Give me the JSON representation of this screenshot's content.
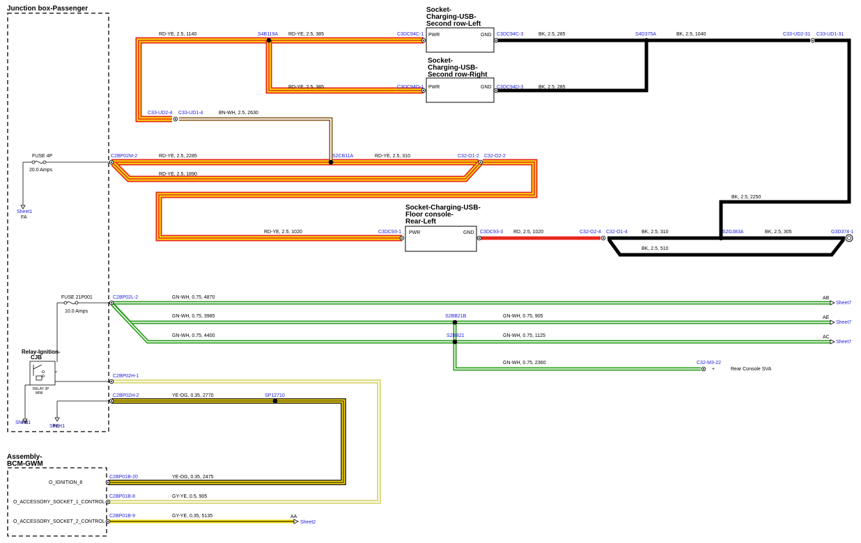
{
  "blocks": {
    "junction_box": "Junction box-Passenger",
    "bcm": [
      "Assembly-",
      "BCM-GWM"
    ],
    "usb_left": [
      "Socket-",
      "Charging-USB-",
      "Second row-Left"
    ],
    "usb_right": [
      "Socket-",
      "Charging-USB-",
      "Second row-Right"
    ],
    "usb_floor": [
      "Socket-Charging-USB-",
      "Floor console-",
      "Rear-Left"
    ],
    "relay": [
      "Relay-Ignition-",
      "CJB"
    ]
  },
  "pins": {
    "pwr": "PWR",
    "gnd": "GND"
  },
  "fuses": {
    "f4p": {
      "name": "FUSE 4P",
      "rating": "20.0 Amps"
    },
    "f21": {
      "name": "FUSE 21P001",
      "rating": "10.0 Amps"
    },
    "relay_type": [
      "RELAY 2P",
      "MINI"
    ]
  },
  "connectors": {
    "c2bp02m2": "C2BP02M-2",
    "s4b119a": "S4B119A",
    "c3dc94c1": "C3DC94C-1",
    "c3dc94c3": "C3DC94C-3",
    "s4d375a": "S4D375A",
    "c33ud231": "C33-UD2-31",
    "c33ud131": "C33-UD1-31",
    "c3dc94d1": "C3DC94D-1",
    "c3dc94d3": "C3DC94D-3",
    "c33ud24": "C33-UD2-4",
    "c33ud14": "C33-UD1-4",
    "s2cb11a": "S2CB11A",
    "c32o12": "C32-O1-2",
    "c32o22": "C32-O2-2",
    "c3dc931": "C3DC93-1",
    "c3dc933": "C3DC93-3",
    "c32o24": "C32-O2-4",
    "c32o14": "C32-O1-4",
    "s2g383a": "S2G383A",
    "g3d374": "G3D374-1",
    "c2bp02l2": "C2BP02L-2",
    "s2bb21b": "S2BB21B",
    "s2bb21": "S2BB21",
    "c32m322": "C32-M3-22",
    "c2bp02h1": "C2BP02H-1",
    "c2bp02h2": "C2BP02H-2",
    "sp12710": "SP12710",
    "c2bp01b20": "C2BP01B-20",
    "c2bp01b8": "C2BP01B-8",
    "c2bp01b9": "C2BP01B-9"
  },
  "wires": {
    "w1140": "RD-YE,  2.5,  1140",
    "w385a": "RD-YE,  2.5,  385",
    "w385b": "RD-YE,  2.5,  385",
    "bk285a": "BK,  2.5,  285",
    "bk285b": "BK,  2.5,  285",
    "bk1040": "BK,  2.5,  1040",
    "bn2630": "BN-WH,  2.5,  2630",
    "w2285": "RD-YE,  2.5,  2285",
    "w310": "RD-YE,  2.5,  310",
    "w1890": "RD-YE,  2.5,  1890",
    "bk2250": "BK,  2.5,  2250",
    "w1020": "RD-YE,  2.5,  1020",
    "rd1020": "RD,  2.5,  1020",
    "bk310": "BK,  2.5,  310",
    "bk305": "BK,  2.5,  305",
    "bk510": "BK,  2.5,  510",
    "g4870": "GN-WH,  0.75,  4870",
    "g3985": "GN-WH,  0.75,  3985",
    "g905": "GN-WH,  0.75,  905",
    "g4400": "GN-WH,  0.75,  4400",
    "g1125": "GN-WH,  0.75,  1125",
    "g2360": "GN-WH,  0.75,  2360",
    "yo2770": "YE-OG,  0.35,  2770",
    "yo2475": "YE-OG,  0.35,  2475",
    "gy905": "GY-YE,  0.5,  905",
    "gy5135": "GY-YE,  0.35,  5135"
  },
  "offpage": {
    "ab": "AB",
    "ae": "AE",
    "ac": "AC",
    "aa": "AA",
    "sheet7": "Sheet7",
    "sheet2": "Sheet2",
    "sheet1": "Sheet1",
    "fa": "FA",
    "fb": "FB",
    "fc": "FC"
  },
  "signals": {
    "ign": "O_IGNITION_8",
    "acc1": "O_ACCESSORY_SOCKET_1_CONTROL",
    "acc2": "O_ACCESSORY_SOCKET_2_CONTROL",
    "rear_console": "Rear Console SVA",
    "plus": "+"
  },
  "colors": {
    "rd_ye": "#e8271c",
    "ye": "#f7dc0b",
    "bk": "#000000",
    "bn": "#8a5a1c",
    "gn": "#2f9f20",
    "ye_og": "#f7dc0b",
    "gy_ye": "#d6d66e",
    "label_blue": "#1a1adc"
  }
}
